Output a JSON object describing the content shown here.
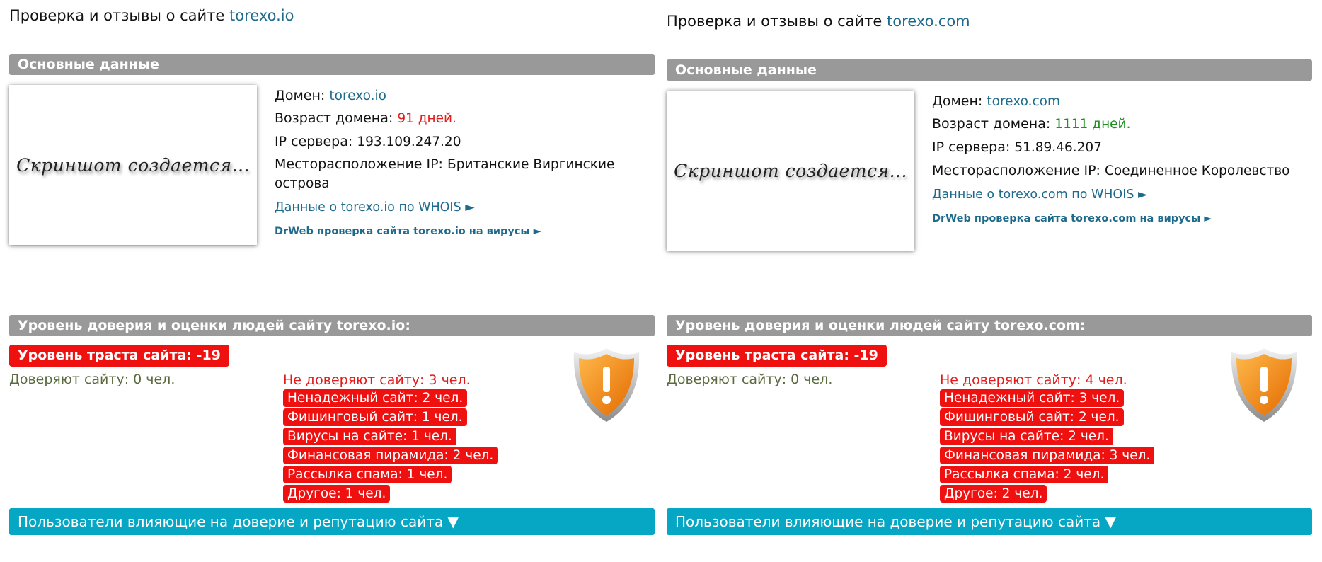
{
  "sites": [
    {
      "title_prefix": "Проверка и отзывы о сайте",
      "domain": "torexo.io",
      "basic_header": "Основные данные",
      "screenshot_text": "Скриншот создается...",
      "domain_label": "Домен:",
      "age_label": "Возраст домена:",
      "age_value": "91 дней.",
      "age_color": "#e31b1b",
      "ip_label": "IP сервера:",
      "ip_value": "193.109.247.20",
      "location_label": "Месторасположение IP:",
      "location_value": "Британские Виргинские острова",
      "whois_link": "Данные о torexo.io по WHOIS ►",
      "drweb_link": "DrWeb проверка сайта torexo.io на вирусы ►",
      "trust_header": "Уровень доверия и оценки людей сайту torexo.io:",
      "trust_level": "Уровень траста сайта: -19",
      "trusted": "Доверяют сайту: 0 чел.",
      "distrusted": "Не доверяют сайту: 3 чел.",
      "reasons": [
        "Ненадежный сайт: 2 чел.",
        "Фишинговый сайт: 1 чел.",
        "Вирусы на сайте: 1 чел.",
        "Финансовая пирамида: 2 чел.",
        "Рассылка спама: 1 чел.",
        "Другое: 1 чел."
      ],
      "users_toggle": "Пользователи влияющие на доверие и репутацию сайта ▼",
      "shield_icon": "warning-shield-icon"
    },
    {
      "title_prefix": "Проверка и отзывы о сайте",
      "domain": "torexo.com",
      "basic_header": "Основные данные",
      "screenshot_text": "Скриншот создается...",
      "domain_label": "Домен:",
      "age_label": "Возраст домена:",
      "age_value": "1111 дней.",
      "age_color": "#1f8f1f",
      "ip_label": "IP сервера:",
      "ip_value": "51.89.46.207",
      "location_label": "Месторасположение IP:",
      "location_value": "Соединенное Королевство",
      "whois_link": "Данные о torexo.com по WHOIS ►",
      "drweb_link": "DrWeb проверка сайта torexo.com на вирусы ►",
      "trust_header": "Уровень доверия и оценки людей сайту torexo.com:",
      "trust_level": "Уровень траста сайта: -19",
      "trusted": "Доверяют сайту: 0 чел.",
      "distrusted": "Не доверяют сайту: 4 чел.",
      "reasons": [
        "Ненадежный сайт: 3 чел.",
        "Фишинговый сайт: 2 чел.",
        "Вирусы на сайте: 2 чел.",
        "Финансовая пирамида: 3 чел.",
        "Рассылка спама: 2 чел.",
        "Другое: 2 чел."
      ],
      "users_toggle": "Пользователи влияющие на доверие и репутацию сайта ▼",
      "shield_icon": "warning-shield-icon"
    }
  ]
}
